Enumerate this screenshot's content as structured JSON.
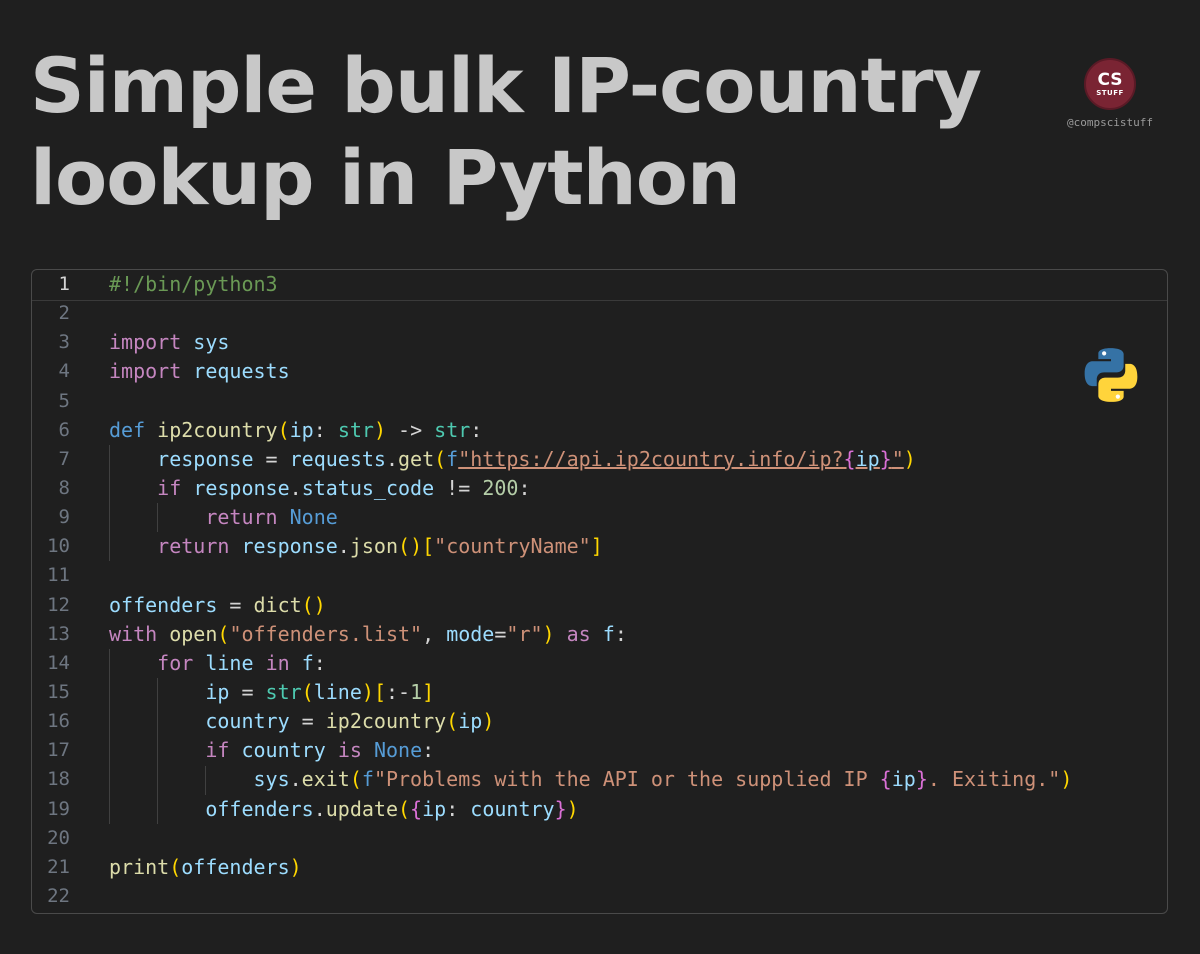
{
  "title": {
    "line1": "Simple bulk IP-country",
    "line2": "lookup in Python"
  },
  "brand": {
    "logo_big": "CS",
    "logo_small": "STUFF",
    "handle": "@compscistuff"
  },
  "editor": {
    "language_icon": "python-logo-icon",
    "line_numbers": [
      "1",
      "2",
      "3",
      "4",
      "5",
      "6",
      "7",
      "8",
      "9",
      "10",
      "11",
      "12",
      "13",
      "14",
      "15",
      "16",
      "17",
      "18",
      "19",
      "20",
      "21",
      "22"
    ],
    "active_line": "1",
    "code_lines": [
      "#!/bin/python3",
      "",
      "import sys",
      "import requests",
      "",
      "def ip2country(ip: str) -> str:",
      "    response = requests.get(f\"https://api.ip2country.info/ip?{ip}\")",
      "    if response.status_code != 200:",
      "        return None",
      "    return response.json()[\"countryName\"]",
      "",
      "offenders = dict()",
      "with open(\"offenders.list\", mode=\"r\") as f:",
      "    for line in f:",
      "        ip = str(line)[:-1]",
      "        country = ip2country(ip)",
      "        if country is None:",
      "            sys.exit(f\"Problems with the API or the supplied IP {ip}. Exiting.\")",
      "        offenders.update({ip: country})",
      "",
      "print(offenders)",
      ""
    ]
  }
}
